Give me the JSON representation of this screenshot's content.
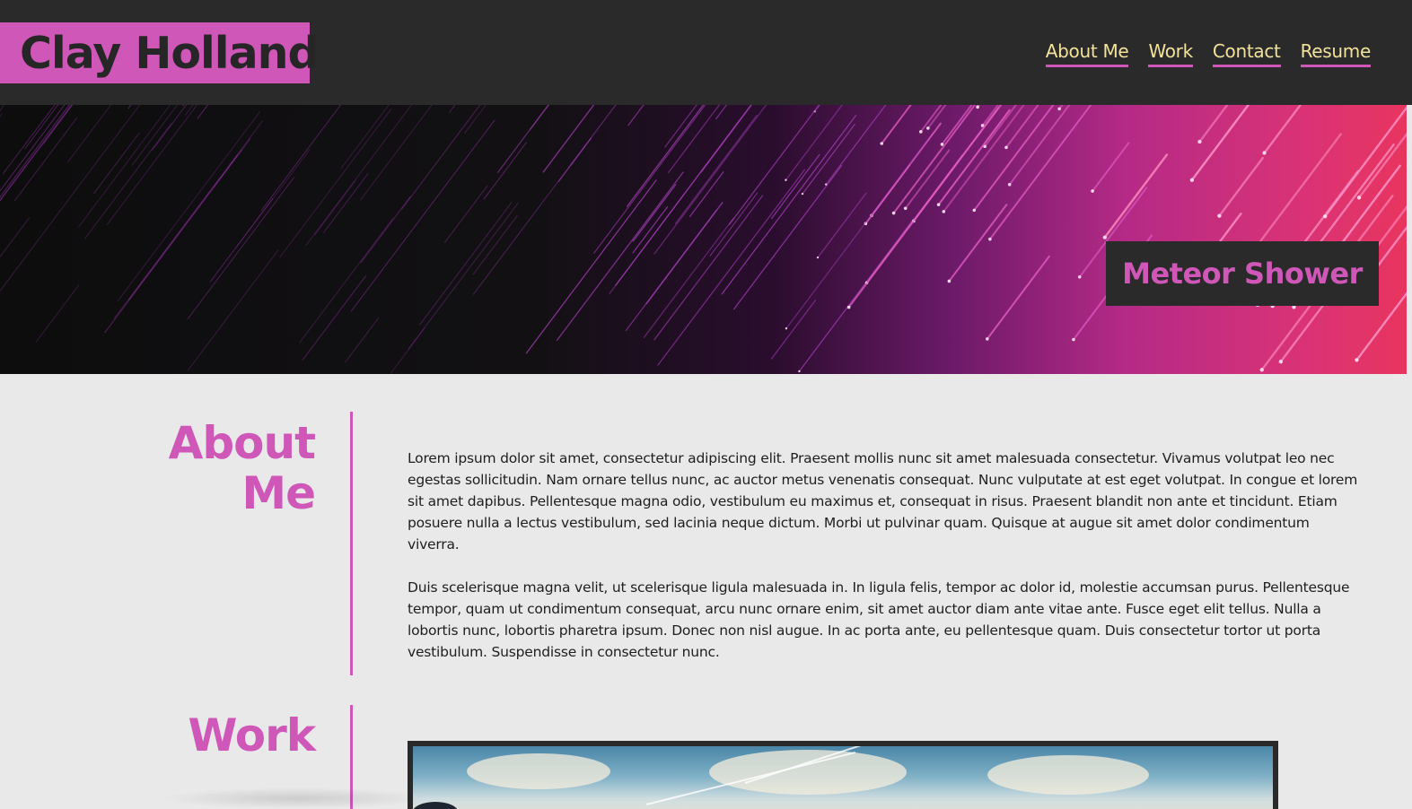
{
  "header": {
    "brand": "Clay Holland",
    "nav": [
      {
        "label": "About Me"
      },
      {
        "label": "Work"
      },
      {
        "label": "Contact"
      },
      {
        "label": "Resume"
      }
    ]
  },
  "hero": {
    "caption": "Meteor Shower"
  },
  "about": {
    "title_line1": "About",
    "title_line2": "Me",
    "paragraphs": [
      "Lorem ipsum dolor sit amet, consectetur adipiscing elit. Praesent mollis nunc sit amet malesuada consectetur. Vivamus volutpat leo nec egestas sollicitudin. Nam ornare tellus nunc, ac auctor metus venenatis consequat. Nunc vulputate at est eget volutpat. In congue et lorem sit amet dapibus. Pellentesque magna odio, vestibulum eu maximus et, consequat in risus. Praesent blandit non ante et tincidunt. Etiam posuere nulla a lectus vestibulum, sed lacinia neque dictum. Morbi ut pulvinar quam. Quisque at augue sit amet dolor condimentum viverra.",
      "Duis scelerisque magna velit, ut scelerisque ligula malesuada in. In ligula felis, tempor ac dolor id, molestie accumsan purus. Pellentesque tempor, quam ut condimentum consequat, arcu nunc ornare enim, sit amet auctor diam ante vitae ante. Fusce eget elit tellus. Nulla a lobortis nunc, lobortis pharetra ipsum. Donec non nisl augue. In ac porta ante, eu pellentesque quam. Duis consectetur tortor ut porta vestibulum. Suspendisse in consectetur nunc."
    ]
  },
  "work": {
    "title": "Work"
  },
  "colors": {
    "accent": "#cf57b8",
    "header_bg": "#2a2a2a",
    "nav_text": "#f2e29a",
    "page_bg": "#e9e9e9"
  }
}
